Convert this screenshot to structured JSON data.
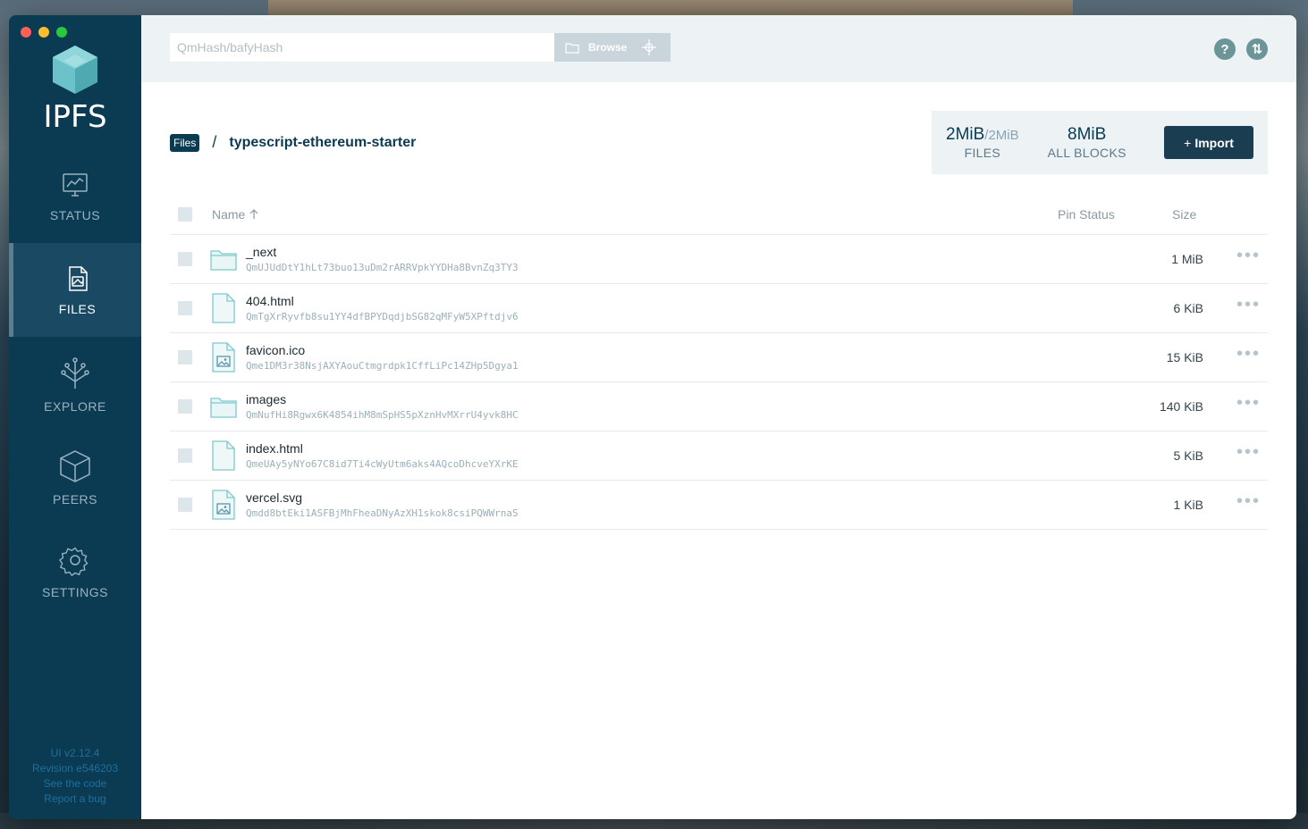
{
  "app": {
    "logo_text": "IPFS"
  },
  "sidebar": {
    "items": [
      {
        "label": "STATUS",
        "icon": "status-icon",
        "active": false
      },
      {
        "label": "FILES",
        "icon": "files-icon",
        "active": true
      },
      {
        "label": "EXPLORE",
        "icon": "explore-icon",
        "active": false
      },
      {
        "label": "PEERS",
        "icon": "peers-icon",
        "active": false
      },
      {
        "label": "SETTINGS",
        "icon": "settings-icon",
        "active": false
      }
    ],
    "footer": {
      "version": "UI v2.12.4",
      "revision": "Revision e546203",
      "see_code": "See the code",
      "report_bug": "Report a bug"
    }
  },
  "topbar": {
    "search_placeholder": "QmHash/bafyHash",
    "browse_label": "Browse"
  },
  "breadcrumb": {
    "root": "Files",
    "separator": "/",
    "current": "typescript-ethereum-starter"
  },
  "stats": {
    "files_size": "2MiB",
    "files_total": "/2MiB",
    "files_label": "FILES",
    "blocks_size": "8MiB",
    "blocks_label": "ALL BLOCKS",
    "import_label": "Import",
    "import_prefix": "+"
  },
  "table": {
    "headers": {
      "name": "Name",
      "pin": "Pin Status",
      "size": "Size"
    },
    "rows": [
      {
        "name": "_next",
        "hash": "QmUJUdDtY1hLt73buo13uDm2rARRVpkYYDHa8BvnZq3TY3",
        "size": "1 MiB",
        "type": "folder"
      },
      {
        "name": "404.html",
        "hash": "QmTgXrRyvfb8su1YY4dfBPYDqdjbSG82qMFyW5XPftdjv6",
        "size": "6 KiB",
        "type": "file"
      },
      {
        "name": "favicon.ico",
        "hash": "Qme1DM3r38NsjAXYAouCtmgrdpk1CffLiPc14ZHp5Dgya1",
        "size": "15 KiB",
        "type": "image"
      },
      {
        "name": "images",
        "hash": "QmNufHi8Rgwx6K4854ihM8mSpHS5pXznHvMXrrU4yvk8HC",
        "size": "140 KiB",
        "type": "folder"
      },
      {
        "name": "index.html",
        "hash": "QmeUAy5yNYo67C8id7Ti4cWyUtm6aks4AQcoDhcveYXrKE",
        "size": "5 KiB",
        "type": "file"
      },
      {
        "name": "vercel.svg",
        "hash": "Qmdd8btEki1ASFBjMhFheaDNyAzXH1skok8csiPQWWrnaS",
        "size": "1 KiB",
        "type": "image"
      }
    ]
  },
  "colors": {
    "sidebar": "#0b3a53",
    "accent": "#6b9598",
    "folder": "#7fc8cf"
  }
}
